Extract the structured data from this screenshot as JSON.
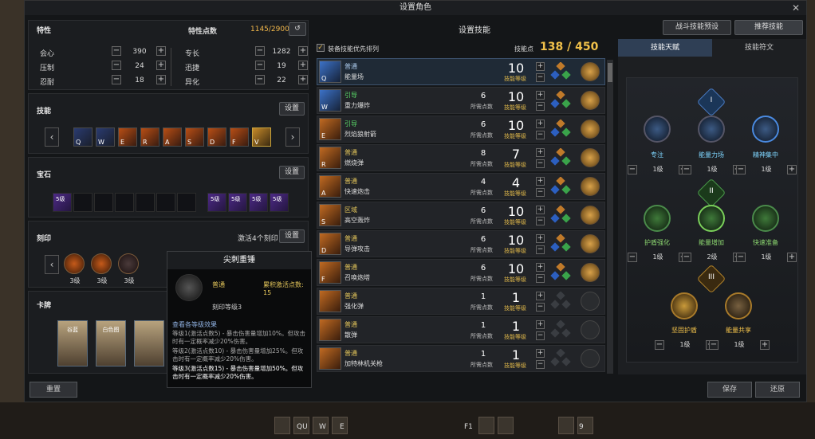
{
  "window": {
    "title": "设置角色"
  },
  "left": {
    "traits": {
      "header": "特性",
      "points_label": "特性点数",
      "points_value": "1145/2900",
      "stats": [
        {
          "label": "会心",
          "value": "390"
        },
        {
          "label": "压制",
          "value": "24"
        },
        {
          "label": "忍耐",
          "value": "18"
        },
        {
          "label": "专长",
          "value": "1282"
        },
        {
          "label": "迅捷",
          "value": "19"
        },
        {
          "label": "异化",
          "value": "22"
        }
      ]
    },
    "skills": {
      "header": "技能",
      "set_button": "设置",
      "keys": [
        "Q",
        "W",
        "E",
        "R",
        "A",
        "S",
        "D",
        "F",
        "V"
      ]
    },
    "gems": {
      "header": "宝石",
      "set_button": "设置",
      "slots": [
        "5级",
        "",
        "",
        "",
        "",
        "",
        "",
        "5级",
        "5级",
        "5级",
        "5级"
      ]
    },
    "engravings": {
      "header": "刻印",
      "active_label": "激活4个刻印",
      "set_button": "设置",
      "items": [
        "3级",
        "3级",
        "3级"
      ]
    },
    "cards": {
      "header": "卡牌",
      "set_button": "设置",
      "names": [
        "谷蓝",
        "白色图"
      ]
    },
    "reset_button": "重置"
  },
  "tooltip": {
    "title": "尖刺重锤",
    "type": "普通",
    "accum": "累积激活点数: 15",
    "level": "刻印等级3",
    "section": "查看各等级效果",
    "lines": [
      "等级1(激活点数5) - 暴击伤害量增加10%。但攻击时有一定概率减少20%伤害。",
      "等级2(激活点数10) - 暴击伤害量增加25%。但攻击时有一定概率减少20%伤害。",
      "等级3(激活点数15) - 暴击伤害量增加50%。但攻击时有一定概率减少20%伤害。"
    ]
  },
  "middle": {
    "header": "设置技能",
    "checkbox_label": "装备技能优先排列",
    "points_label": "技能点",
    "points_value": "138 / 450",
    "rows": [
      {
        "key": "Q",
        "type": "普通",
        "name": "能量场",
        "pts": "",
        "lv": "10",
        "type_color": "#a9c7e8",
        "rune": true
      },
      {
        "key": "W",
        "type": "引导",
        "name": "重力爆炸",
        "pts": "6",
        "lv": "10",
        "type_color": "#5be06a",
        "rune": true
      },
      {
        "key": "E",
        "type": "引导",
        "name": "烈焰狼射箭",
        "pts": "6",
        "lv": "10",
        "type_color": "#5be06a",
        "rune": true
      },
      {
        "key": "R",
        "type": "普通",
        "name": "燃烧弹",
        "pts": "8",
        "lv": "7",
        "type_color": "#e3c55a",
        "rune": true
      },
      {
        "key": "A",
        "type": "普通",
        "name": "快速炮击",
        "pts": "4",
        "lv": "4",
        "type_color": "#e3c55a",
        "rune": true
      },
      {
        "key": "S",
        "type": "区域",
        "name": "高空轰炸",
        "pts": "6",
        "lv": "10",
        "type_color": "#e3c55a",
        "rune": true
      },
      {
        "key": "D",
        "type": "普通",
        "name": "导弹攻击",
        "pts": "6",
        "lv": "10",
        "type_color": "#e3c55a",
        "rune": true
      },
      {
        "key": "F",
        "type": "普通",
        "name": "召唤炮塔",
        "pts": "6",
        "lv": "10",
        "type_color": "#e3c55a",
        "rune": true
      },
      {
        "key": "",
        "type": "普通",
        "name": "强化弹",
        "pts": "1",
        "lv": "1",
        "type_color": "#e3c55a",
        "rune": false
      },
      {
        "key": "",
        "type": "普通",
        "name": "散弹",
        "pts": "1",
        "lv": "1",
        "type_color": "#e3c55a",
        "rune": false
      },
      {
        "key": "",
        "type": "普通",
        "name": "加特林机关枪",
        "pts": "1",
        "lv": "1",
        "type_color": "#e3c55a",
        "rune": false
      }
    ],
    "pts_label": "所需点数",
    "lv_label": "技能等级"
  },
  "right": {
    "preset_button": "战斗技能预设",
    "recommend_button": "推荐技能",
    "tab_talent": "技能天赋",
    "tab_rune": "技能符文",
    "tier1": [
      {
        "name": "专注",
        "lv": "1级"
      },
      {
        "name": "能量力场",
        "lv": "1级"
      },
      {
        "name": "精神集中",
        "lv": "1级"
      }
    ],
    "tier2": [
      {
        "name": "护盾强化",
        "lv": "1级"
      },
      {
        "name": "能量增加",
        "lv": "2级"
      },
      {
        "name": "快速准备",
        "lv": "1级"
      }
    ],
    "tier3": [
      {
        "name": "坚固护盾",
        "lv": "1级"
      },
      {
        "name": "能量共享",
        "lv": "1级"
      }
    ],
    "tier_marks": [
      "I",
      "II",
      "III"
    ],
    "save_button": "保存",
    "restore_button": "还原"
  },
  "bottom": {
    "keys": [
      "QU",
      "W",
      "E",
      "F1",
      "9"
    ]
  }
}
